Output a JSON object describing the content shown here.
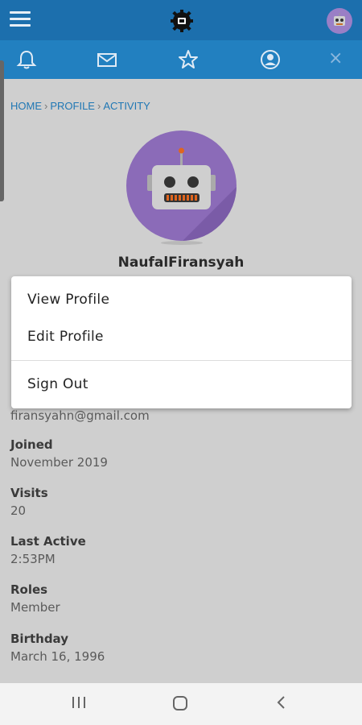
{
  "header": {
    "menu_icon": "hamburger-menu-icon",
    "logo_icon": "gear-logo-icon",
    "avatar_icon": "robot-avatar-icon",
    "bar_color": "#1c6fad"
  },
  "icon_bar": {
    "icons": [
      "bell-icon",
      "mail-icon",
      "star-icon",
      "user-circle-icon"
    ],
    "close": "×",
    "bar_color": "#2280c0"
  },
  "breadcrumb": {
    "items": [
      "HOME",
      "PROFILE",
      "ACTIVITY"
    ],
    "separator": "›"
  },
  "profile": {
    "username": "NaufalFiransyah",
    "email": "firansyahn@gmail.com",
    "fields": [
      {
        "label": "Joined",
        "value": "November 2019"
      },
      {
        "label": "Visits",
        "value": "20"
      },
      {
        "label": "Last Active",
        "value": "2:53PM"
      },
      {
        "label": "Roles",
        "value": "Member"
      },
      {
        "label": "Birthday",
        "value": "March 16, 1996"
      }
    ]
  },
  "dropdown": {
    "view_profile": "View Profile",
    "edit_profile": "Edit Profile",
    "sign_out": "Sign Out"
  },
  "system_nav": {
    "icons": [
      "recent-apps-icon",
      "home-icon",
      "back-icon"
    ]
  }
}
